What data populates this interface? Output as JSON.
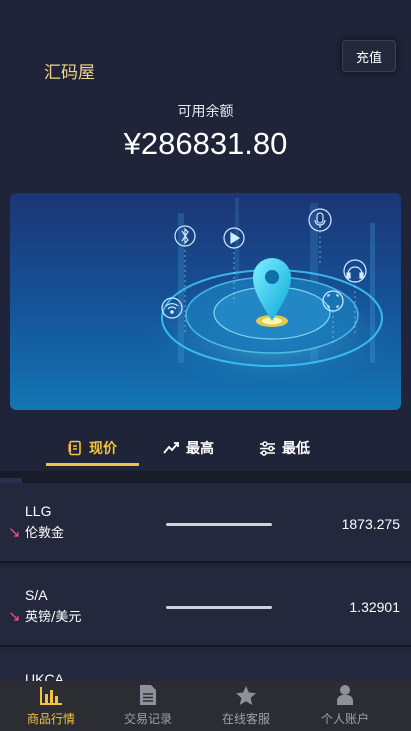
{
  "header": {
    "site_name": "汇码屋",
    "recharge_label": "充值",
    "balance_label": "可用余额",
    "balance_value": "¥286831.80"
  },
  "banner": {
    "icons": [
      "bluetooth-icon",
      "play-icon",
      "microphone-icon",
      "headset-icon",
      "wifi-icon",
      "scan-icon",
      "location-pin-icon"
    ]
  },
  "tabs": [
    {
      "label": "现价",
      "icon": "price-tag-icon",
      "active": true
    },
    {
      "label": "最高",
      "icon": "trend-up-icon",
      "active": false
    },
    {
      "label": "最低",
      "icon": "filter-sliders-icon",
      "active": false
    }
  ],
  "quotes": [
    {
      "code": "LLG",
      "name": "伦敦金",
      "price": "1873.275",
      "trend": "down"
    },
    {
      "code": "S/A",
      "name": "英镑/美元",
      "price": "1.32901",
      "trend": "down"
    },
    {
      "code": "UKCA",
      "name": "",
      "price": "",
      "trend": ""
    }
  ],
  "bottom_nav": [
    {
      "label": "商品行情",
      "icon": "bar-chart-icon",
      "active": true
    },
    {
      "label": "交易记录",
      "icon": "document-icon",
      "active": false
    },
    {
      "label": "在线客服",
      "icon": "star-icon",
      "active": false
    },
    {
      "label": "个人账户",
      "icon": "person-icon",
      "active": false
    }
  ],
  "colors": {
    "accent": "#f4c23e",
    "background": "#1f2438",
    "down": "#ff4f7b",
    "site_name": "#f3d487"
  }
}
